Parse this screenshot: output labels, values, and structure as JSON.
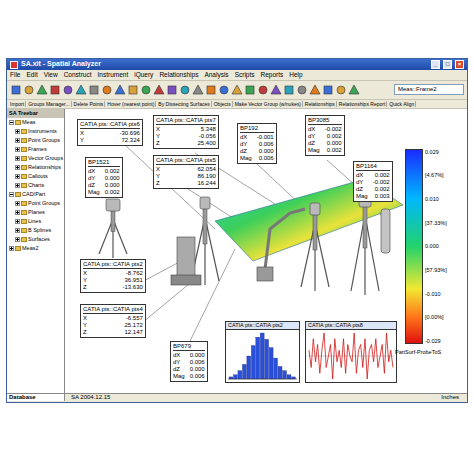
{
  "window": {
    "title": "SA.xit - Spatial Analyzer",
    "controls": [
      "_",
      "□",
      "×"
    ]
  },
  "menu": [
    "File",
    "Edit",
    "View",
    "Construct",
    "Instrument",
    "iQuery",
    "Relationships",
    "Analysis",
    "Scripts",
    "Reports",
    "Help"
  ],
  "toolbar": {
    "combo": "Meas::Frame2",
    "items": [
      "Import",
      "Groups Manager...",
      "Delete Points",
      "Hover (nearest point)",
      "By Dissecting Surfaces",
      "Objects",
      "Make Vector Group (w/nukes)",
      "Relationships",
      "Relationships Report",
      "Quick Align"
    ]
  },
  "tree": {
    "title": "SA Treebar",
    "items": [
      {
        "label": "Meas",
        "depth": 0,
        "expanded": true
      },
      {
        "label": "Instruments",
        "depth": 1,
        "expanded": false
      },
      {
        "label": "Point Groups",
        "depth": 1,
        "expanded": false
      },
      {
        "label": "Frames",
        "depth": 1,
        "expanded": false
      },
      {
        "label": "Vector Groups",
        "depth": 1,
        "expanded": false
      },
      {
        "label": "Relationships",
        "depth": 1,
        "expanded": false
      },
      {
        "label": "Callouts",
        "depth": 1,
        "expanded": false
      },
      {
        "label": "Charts",
        "depth": 1,
        "expanded": false
      },
      {
        "label": "CAD/Part",
        "depth": 0,
        "expanded": true
      },
      {
        "label": "Point Groups",
        "depth": 1,
        "expanded": false
      },
      {
        "label": "Planes",
        "depth": 1,
        "expanded": false
      },
      {
        "label": "Lines",
        "depth": 1,
        "expanded": false
      },
      {
        "label": "B Splines",
        "depth": 1,
        "expanded": false
      },
      {
        "label": "Surfaces",
        "depth": 1,
        "expanded": false
      },
      {
        "label": "Meas2",
        "depth": 0,
        "expanded": false
      }
    ]
  },
  "callouts": [
    {
      "title": "CATIA pts::CATIA pts6",
      "rows": [
        [
          "X",
          "-30.696"
        ],
        [
          "Y",
          "72.324"
        ]
      ]
    },
    {
      "title": "CATIA pts::CATIA pts7",
      "rows": [
        [
          "X",
          "5.348"
        ],
        [
          "Y",
          "-0.056"
        ],
        [
          "Z",
          "25.400"
        ]
      ]
    },
    {
      "title": "BP192",
      "rows": [
        [
          "dX",
          "-0.001"
        ],
        [
          "dY",
          "0.006"
        ],
        [
          "dZ",
          "0.000"
        ],
        [
          "Mag",
          "0.006"
        ]
      ]
    },
    {
      "title": "BP3085",
      "rows": [
        [
          "dX",
          "-0.002"
        ],
        [
          "dY",
          "0.002"
        ],
        [
          "dZ",
          "0.000"
        ],
        [
          "Mag",
          "0.002"
        ]
      ]
    },
    {
      "title": "BP1521",
      "rows": [
        [
          "dX",
          "0.002"
        ],
        [
          "dY",
          "0.000"
        ],
        [
          "dZ",
          "0.000"
        ],
        [
          "Mag",
          "0.002"
        ]
      ]
    },
    {
      "title": "CATIA pts::CATIA pts5",
      "rows": [
        [
          "X",
          "62.054"
        ],
        [
          "Y",
          "86.190"
        ],
        [
          "Z",
          "16.244"
        ]
      ]
    },
    {
      "title": "BP1164",
      "rows": [
        [
          "dX",
          "0.002"
        ],
        [
          "dY",
          "-0.002"
        ],
        [
          "dZ",
          "0.002"
        ],
        [
          "Mag",
          "0.003"
        ]
      ]
    },
    {
      "title": "CATIA pts::CATIA pts2",
      "rows": [
        [
          "X",
          "-8.762"
        ],
        [
          "Y",
          "36.951"
        ],
        [
          "Z",
          "-13.630"
        ]
      ]
    },
    {
      "title": "CATIA pts::CATIA pts4",
      "rows": [
        [
          "X",
          "-6.557"
        ],
        [
          "Y",
          "25.172"
        ],
        [
          "Z",
          "12.147"
        ]
      ]
    },
    {
      "title": "BP679",
      "rows": [
        [
          "dX",
          "0.000"
        ],
        [
          "dY",
          "0.006"
        ],
        [
          "dZ",
          "0.000"
        ],
        [
          "Mag",
          "0.006"
        ]
      ]
    }
  ],
  "colorbar": {
    "ticks": [
      "0.029",
      "[4.67%]",
      "0.010",
      "[37.33%]",
      "0.000",
      "[57.93%]",
      "-0.010",
      "[0.00%]",
      "-0.029"
    ],
    "label": "PartSurf-ProbeToS"
  },
  "charts": [
    {
      "title": "CATIA pts::CATIA pts2",
      "kind": "histogram",
      "values": [
        1,
        2,
        4,
        7,
        11,
        16,
        20,
        22,
        19,
        15,
        10,
        6,
        4,
        2,
        1
      ]
    },
    {
      "title": "CATIA pts::CATIA pts8",
      "kind": "line",
      "values": [
        0.001,
        -0.002,
        0.003,
        -0.001,
        0.002,
        -0.003,
        0.001,
        0.004,
        -0.002,
        0.0,
        0.002,
        -0.004,
        0.003,
        -0.001,
        0.001,
        -0.002,
        0.003,
        -0.003,
        0.002,
        0.0,
        -0.001,
        0.004,
        -0.003,
        0.001,
        0.002,
        -0.002,
        0.003,
        -0.004,
        0.001,
        0.002,
        -0.001,
        0.003,
        -0.002,
        0.0,
        0.002,
        -0.003,
        0.004,
        -0.001,
        0.001,
        -0.002
      ]
    }
  ],
  "status": {
    "tab": "Database",
    "version": "SA 2004.12.15",
    "units": "Inches"
  }
}
